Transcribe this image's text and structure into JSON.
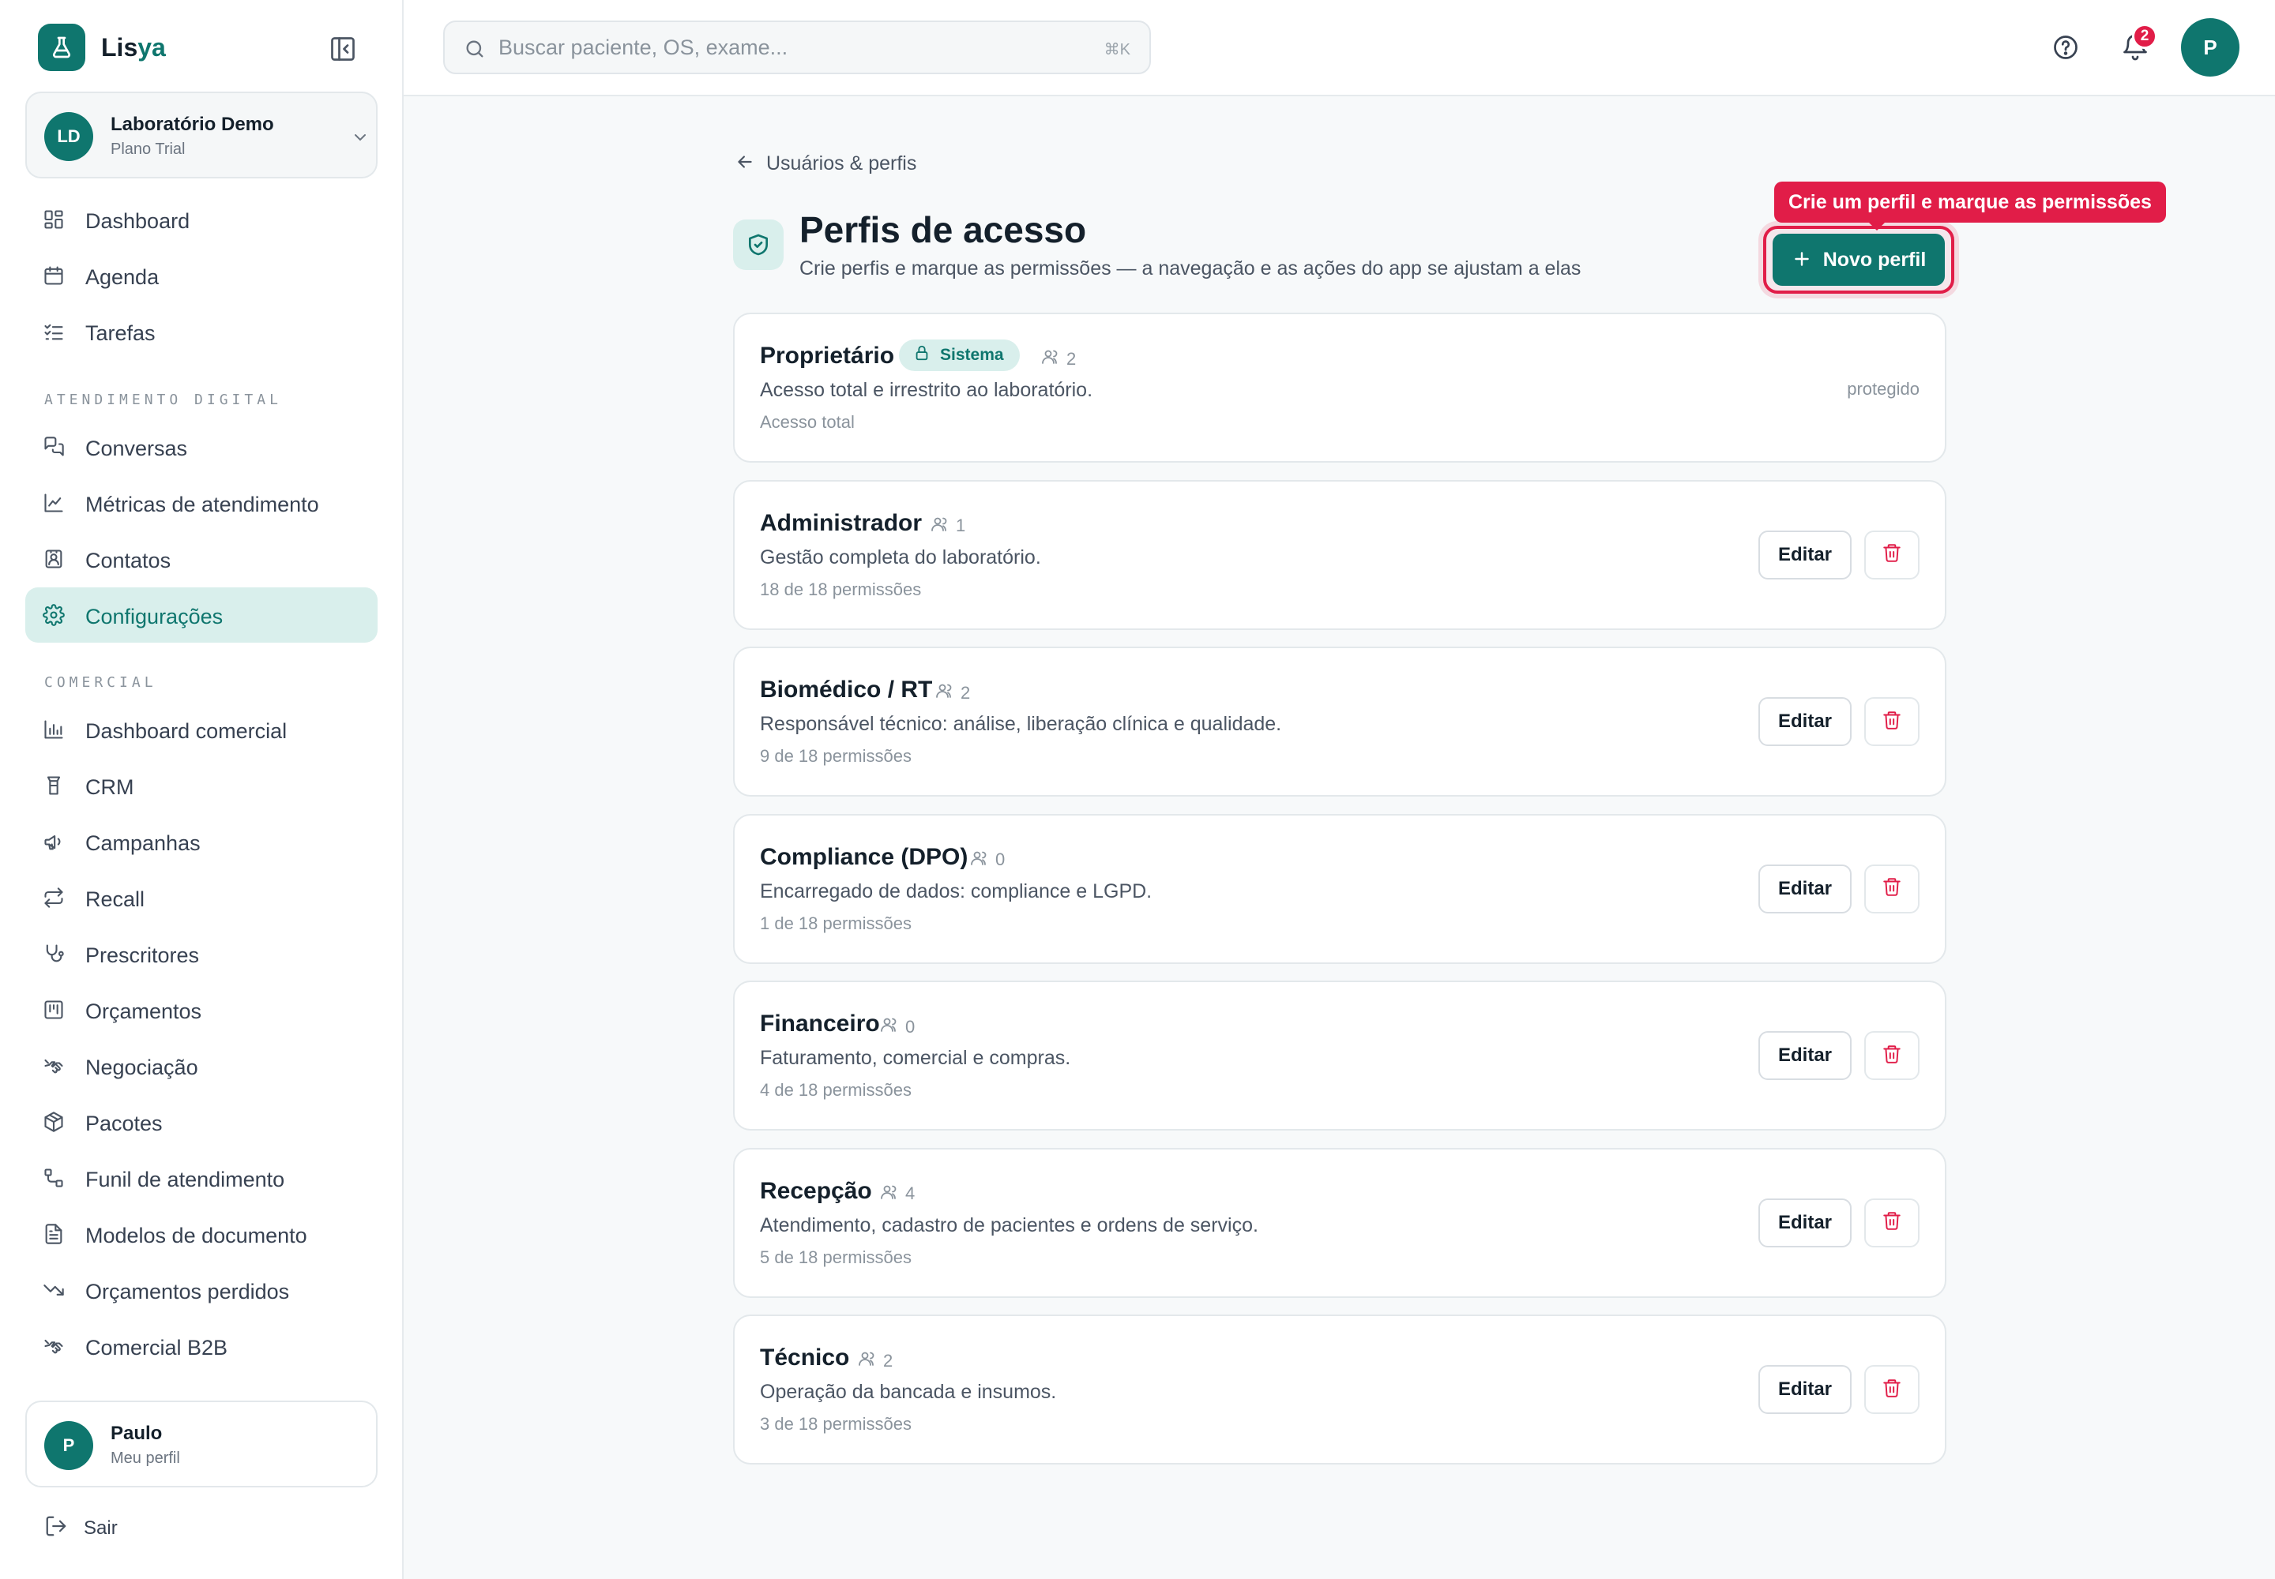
{
  "brand": {
    "name_main": "Lis",
    "name_accent": "ya",
    "primary_color": "#0f766e",
    "alert_color": "#e11d48"
  },
  "lab": {
    "initials": "LD",
    "name": "Laboratório Demo",
    "plan": "Plano Trial"
  },
  "nav": {
    "main": [
      {
        "label": "Dashboard",
        "icon": "dashboard-icon"
      },
      {
        "label": "Agenda",
        "icon": "calendar-icon"
      },
      {
        "label": "Tarefas",
        "icon": "tasks-icon"
      }
    ],
    "section_digital": "ATENDIMENTO DIGITAL",
    "digital": [
      {
        "label": "Conversas",
        "icon": "chat-icon"
      },
      {
        "label": "Métricas de atendimento",
        "icon": "chart-line-icon"
      },
      {
        "label": "Contatos",
        "icon": "contacts-icon"
      },
      {
        "label": "Configurações",
        "icon": "gear-icon",
        "active": true
      }
    ],
    "section_comercial": "COMERCIAL",
    "comercial": [
      {
        "label": "Dashboard comercial",
        "icon": "bar-chart-icon"
      },
      {
        "label": "CRM",
        "icon": "crm-icon"
      },
      {
        "label": "Campanhas",
        "icon": "megaphone-icon"
      },
      {
        "label": "Recall",
        "icon": "repeat-icon"
      },
      {
        "label": "Prescritores",
        "icon": "stethoscope-icon"
      },
      {
        "label": "Orçamentos",
        "icon": "budget-icon"
      },
      {
        "label": "Negociação",
        "icon": "handshake-icon"
      },
      {
        "label": "Pacotes",
        "icon": "package-icon"
      },
      {
        "label": "Funil de atendimento",
        "icon": "funnel-icon"
      },
      {
        "label": "Modelos de documento",
        "icon": "document-icon"
      },
      {
        "label": "Orçamentos perdidos",
        "icon": "trend-down-icon"
      },
      {
        "label": "Comercial B2B",
        "icon": "handshake-icon"
      }
    ]
  },
  "user": {
    "initial": "P",
    "name": "Paulo",
    "subtitle": "Meu perfil",
    "logout": "Sair"
  },
  "topbar": {
    "search_placeholder": "Buscar paciente, OS, exame...",
    "search_shortcut": "⌘K",
    "notifications_count": "2",
    "avatar_initial": "P"
  },
  "page": {
    "back_label": "Usuários & perfis",
    "title": "Perfis de acesso",
    "subtitle": "Crie perfis e marque as permissões — a navegação e as ações do app se ajustam a elas",
    "tooltip": "Crie um perfil e marque as permissões",
    "new_button": "Novo perfil",
    "edit_label": "Editar"
  },
  "profiles": [
    {
      "name": "Proprietário",
      "badge": "Sistema",
      "users": "2",
      "description": "Acesso total e irrestrito ao laboratório.",
      "permissions": "Acesso total",
      "status": "protegido"
    },
    {
      "name": "Administrador",
      "users": "1",
      "description": "Gestão completa do laboratório.",
      "permissions": "18 de 18 permissões"
    },
    {
      "name": "Biomédico / RT",
      "users": "2",
      "description": "Responsável técnico: análise, liberação clínica e qualidade.",
      "permissions": "9 de 18 permissões"
    },
    {
      "name": "Compliance (DPO)",
      "users": "0",
      "description": "Encarregado de dados: compliance e LGPD.",
      "permissions": "1 de 18 permissões"
    },
    {
      "name": "Financeiro",
      "users": "0",
      "description": "Faturamento, comercial e compras.",
      "permissions": "4 de 18 permissões"
    },
    {
      "name": "Recepção",
      "users": "4",
      "description": "Atendimento, cadastro de pacientes e ordens de serviço.",
      "permissions": "5 de 18 permissões"
    },
    {
      "name": "Técnico",
      "users": "2",
      "description": "Operação da bancada e insumos.",
      "permissions": "3 de 18 permissões"
    }
  ]
}
